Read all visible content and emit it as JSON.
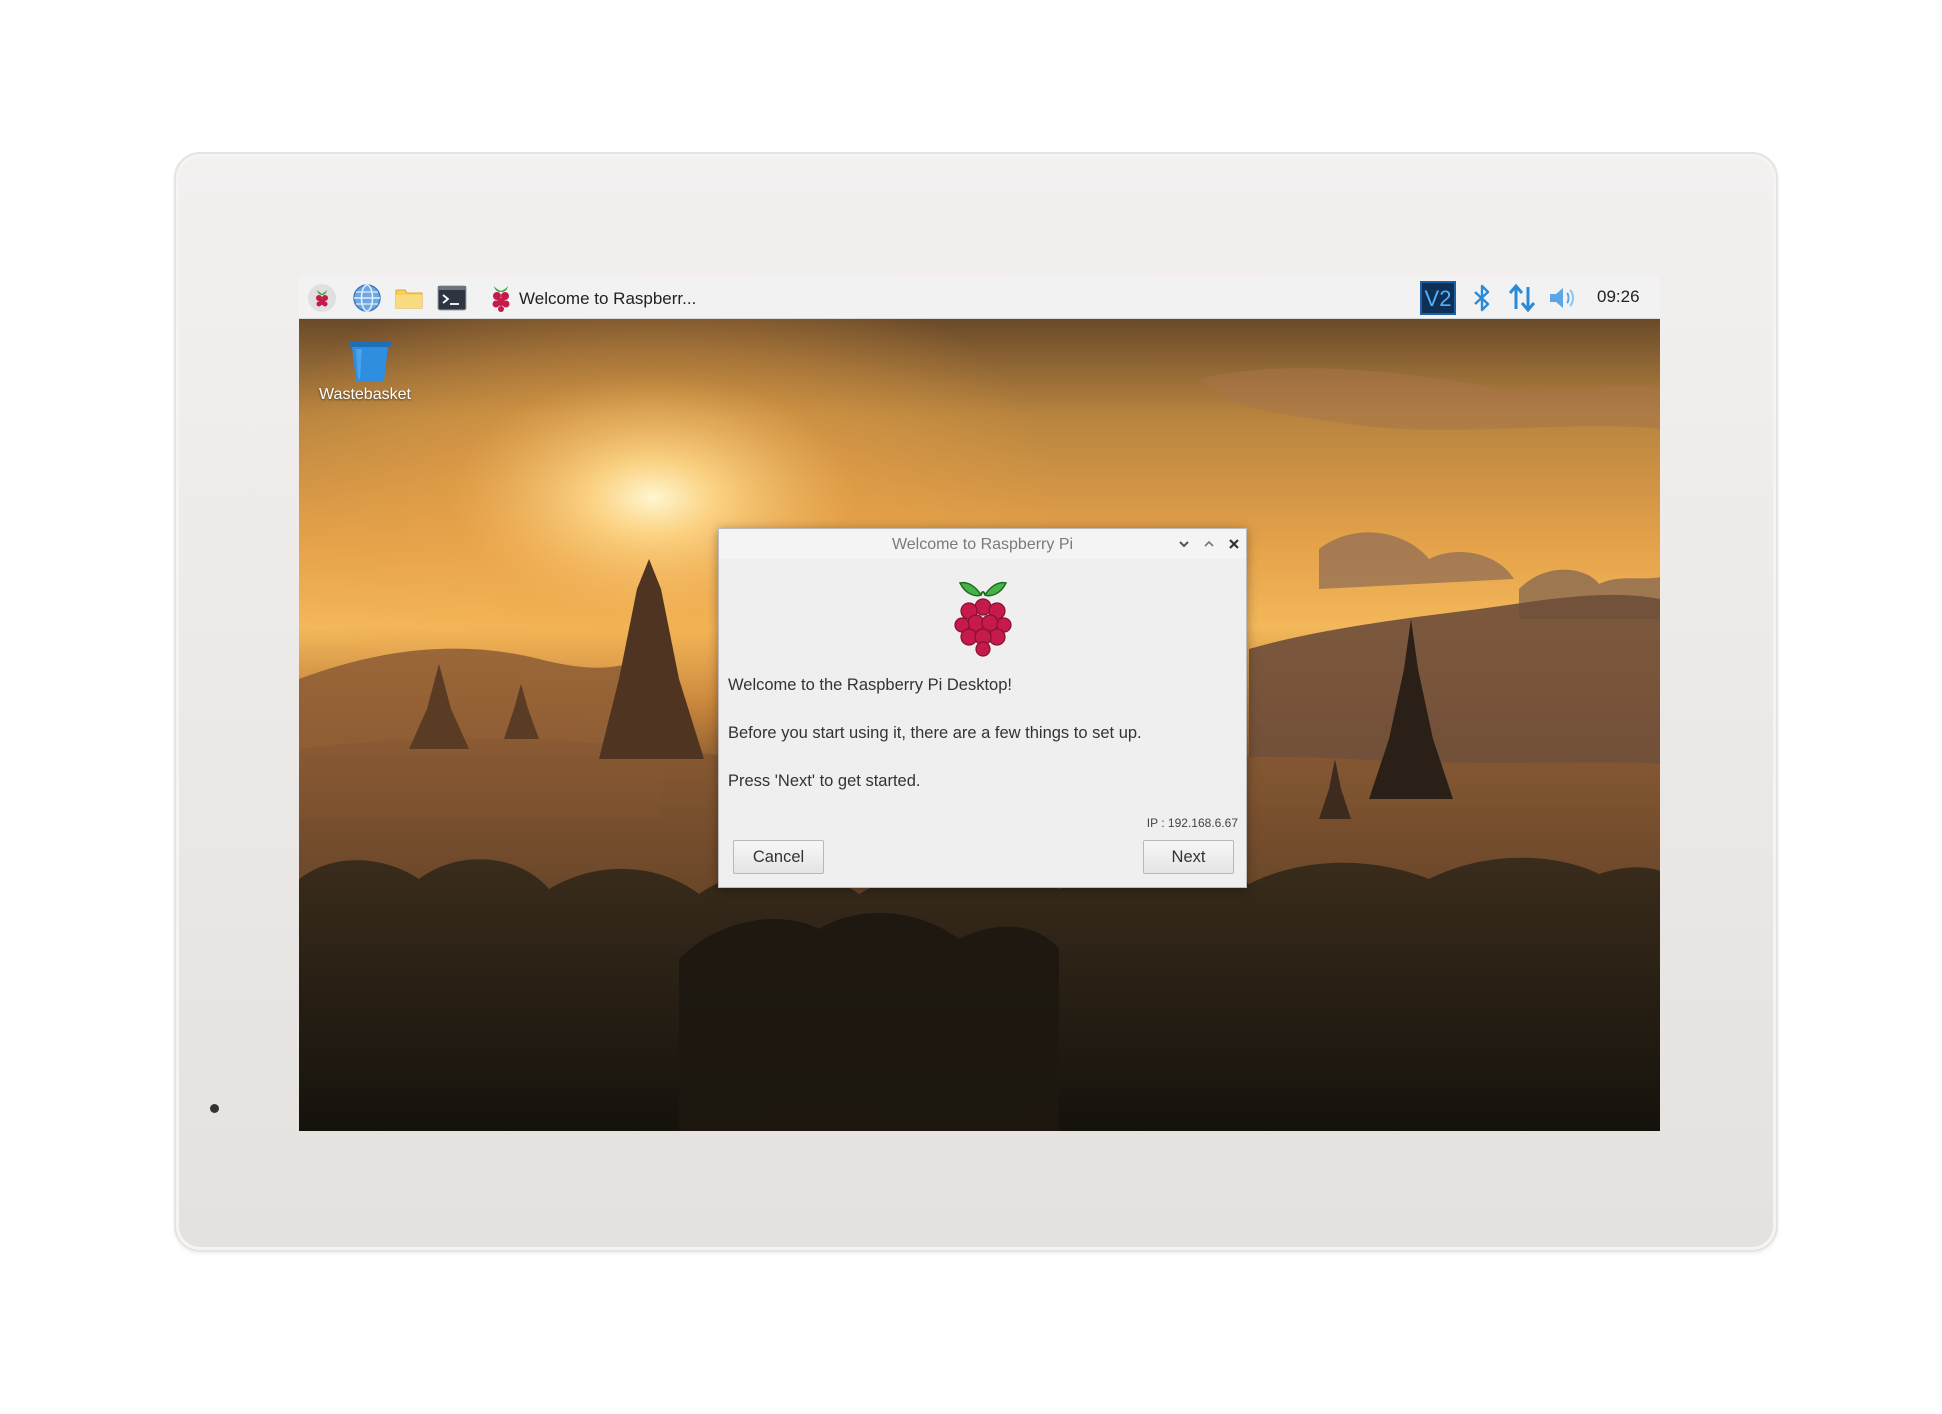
{
  "taskbar": {
    "launchers": [
      {
        "icon": "raspberry-menu-icon"
      },
      {
        "icon": "web-browser-icon"
      },
      {
        "icon": "file-manager-icon"
      },
      {
        "icon": "terminal-icon"
      }
    ],
    "window_button": {
      "icon": "raspberry-icon",
      "label": "Welcome to Raspberr..."
    },
    "tray": {
      "vnc_icon": "vnc-icon",
      "bluetooth_icon": "bluetooth-icon",
      "network_icon": "network-arrows-icon",
      "volume_icon": "volume-icon",
      "clock": "09:26"
    },
    "colors": {
      "background": "#f2f2f2",
      "tray_blue": "#2a8ad6"
    }
  },
  "desktop": {
    "icons": [
      {
        "label": "Wastebasket",
        "icon": "wastebasket-icon"
      }
    ]
  },
  "dialog": {
    "title": "Welcome to Raspberry Pi",
    "controls": [
      "minimize-icon",
      "maximize-icon",
      "close-icon"
    ],
    "logo_icon": "raspberry-pi-logo-icon",
    "messages": {
      "line1": "Welcome to the Raspberry Pi Desktop!",
      "line2": "Before you start using it, there are a few things to set up.",
      "line3": "Press 'Next' to get started."
    },
    "ip": "IP : 192.168.6.67",
    "cancel_label": "Cancel",
    "next_label": "Next"
  }
}
